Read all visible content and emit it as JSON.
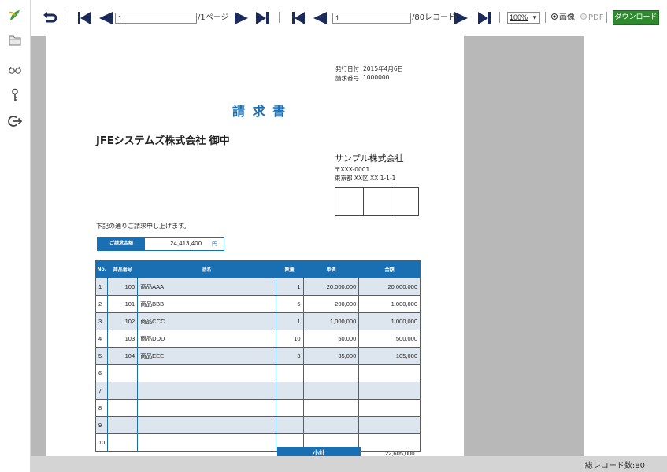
{
  "toolbar": {
    "page_input": "1",
    "page_total": "/1ページ",
    "record_input": "1",
    "record_total": "/80レコード",
    "zoom": "100%",
    "mode_image": "画像",
    "mode_pdf": "PDF",
    "download_label": "ダウンロード"
  },
  "invoice": {
    "issue_date_label": "発行日付",
    "issue_date": "2015年4月6日",
    "invoice_no_label": "請求番号",
    "invoice_no": "1000000",
    "title": "請 求 書",
    "recipient": "JFEシステムズ株式会社 御中",
    "issuer_name": "サンプル株式会社",
    "issuer_zip": "〒XXX-0001",
    "issuer_address": "東京都 XX区 XX 1-1-1",
    "intro": "下記の通りご請求申し上げます。",
    "amount_label": "ご請求金額",
    "amount_value": "24,413,400",
    "amount_unit": "円",
    "headers": [
      "No.",
      "商品番号",
      "品名",
      "数量",
      "単価",
      "金額"
    ],
    "rows": [
      [
        "1",
        "100",
        "商品AAA",
        "1",
        "20,000,000",
        "20,000,000"
      ],
      [
        "2",
        "101",
        "商品BBB",
        "5",
        "200,000",
        "1,000,000"
      ],
      [
        "3",
        "102",
        "商品CCC",
        "1",
        "1,000,000",
        "1,000,000"
      ],
      [
        "4",
        "103",
        "商品DDD",
        "10",
        "50,000",
        "500,000"
      ],
      [
        "5",
        "104",
        "商品EEE",
        "3",
        "35,000",
        "105,000"
      ],
      [
        "6",
        "",
        "",
        "",
        "",
        ""
      ],
      [
        "7",
        "",
        "",
        "",
        "",
        ""
      ],
      [
        "8",
        "",
        "",
        "",
        "",
        ""
      ],
      [
        "9",
        "",
        "",
        "",
        "",
        ""
      ],
      [
        "10",
        "",
        "",
        "",
        "",
        ""
      ]
    ],
    "subtotal_label": "小計",
    "subtotal_value": "22,605,000"
  },
  "status": {
    "record_count": "総レコード数:80"
  },
  "colors": {
    "table_header": "#1a6fb3",
    "title": "#1a6fb3",
    "download_button": "#2f8a2f",
    "logo": "#3a9a3a"
  },
  "icons": [
    "logo-icon",
    "folder-icon",
    "glasses-icon",
    "key-icon",
    "logout-icon",
    "undo-icon",
    "first-page-icon",
    "prev-page-icon",
    "next-page-icon",
    "last-page-icon",
    "first-record-icon",
    "prev-record-icon",
    "next-record-icon",
    "last-record-icon"
  ]
}
